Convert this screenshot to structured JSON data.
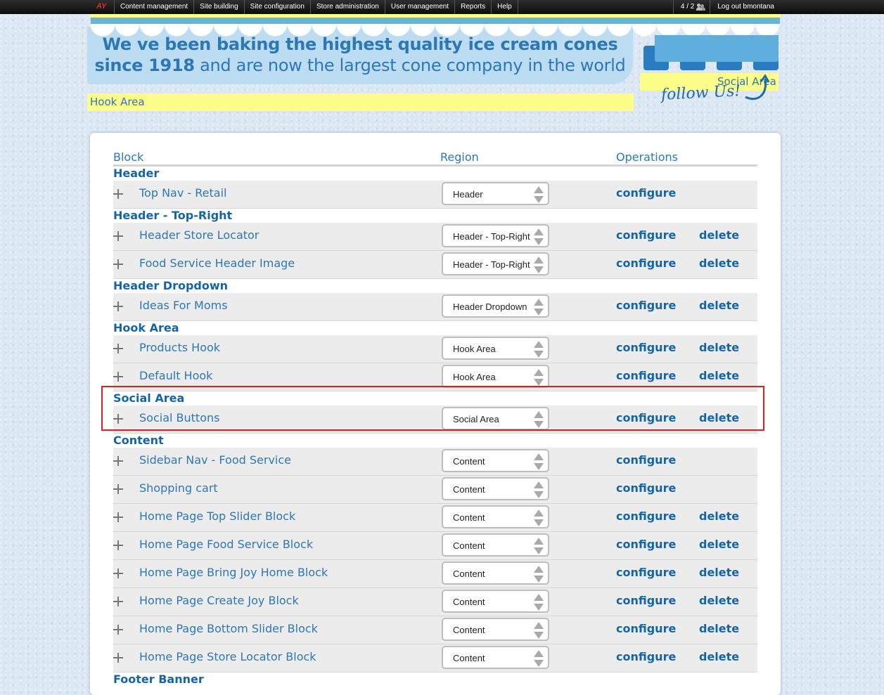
{
  "toolbar": {
    "logo": "AY",
    "menu": [
      "Content management",
      "Site building",
      "Site configuration",
      "Store administration",
      "User management",
      "Reports",
      "Help"
    ],
    "user_count": "4 / 2",
    "logout": "Log out bmontana"
  },
  "banner": {
    "tagline_bold_1": "We ve been baking the highest quality ice cream cones",
    "tagline_bold_2": "since 1918",
    "tagline_rest": " and are now the largest cone company in the world",
    "social_label": "Social Area",
    "follow_text": "follow Us!",
    "hook_label": "Hook Area"
  },
  "table": {
    "headers": {
      "block": "Block",
      "region": "Region",
      "operations": "Operations"
    },
    "configure_label": "configure",
    "delete_label": "delete",
    "regions": [
      {
        "name": "Header",
        "blocks": [
          {
            "name": "Top Nav - Retail",
            "region": "Header",
            "delete": false
          }
        ]
      },
      {
        "name": "Header - Top-Right",
        "blocks": [
          {
            "name": "Header Store Locator",
            "region": "Header - Top-Right",
            "delete": true
          },
          {
            "name": "Food Service Header Image",
            "region": "Header - Top-Right",
            "delete": true
          }
        ]
      },
      {
        "name": "Header Dropdown",
        "blocks": [
          {
            "name": "Ideas For Moms",
            "region": "Header Dropdown",
            "delete": true
          }
        ]
      },
      {
        "name": "Hook Area",
        "blocks": [
          {
            "name": "Products Hook",
            "region": "Hook Area",
            "delete": true
          },
          {
            "name": "Default Hook",
            "region": "Hook Area",
            "delete": true
          }
        ]
      },
      {
        "name": "Social Area",
        "blocks": [
          {
            "name": "Social Buttons",
            "region": "Social Area",
            "delete": true
          }
        ]
      },
      {
        "name": "Content",
        "blocks": [
          {
            "name": "Sidebar Nav - Food Service",
            "region": "Content",
            "delete": false
          },
          {
            "name": "Shopping cart",
            "region": "Content",
            "delete": false
          },
          {
            "name": "Home Page Top Slider Block",
            "region": "Content",
            "delete": true
          },
          {
            "name": "Home Page Food Service Block",
            "region": "Content",
            "delete": true
          },
          {
            "name": "Home Page Bring Joy Home Block",
            "region": "Content",
            "delete": true
          },
          {
            "name": "Home Page Create Joy Block",
            "region": "Content",
            "delete": true
          },
          {
            "name": "Home Page Bottom Slider Block",
            "region": "Content",
            "delete": true
          },
          {
            "name": "Home Page Store Locator Block",
            "region": "Content",
            "delete": true
          }
        ]
      },
      {
        "name": "Footer Banner",
        "blocks": []
      }
    ]
  },
  "colors": {
    "accent": "#1565a6",
    "link": "#2d77b5",
    "highlight": "#fdfd8a",
    "annotation": "#e02020"
  }
}
